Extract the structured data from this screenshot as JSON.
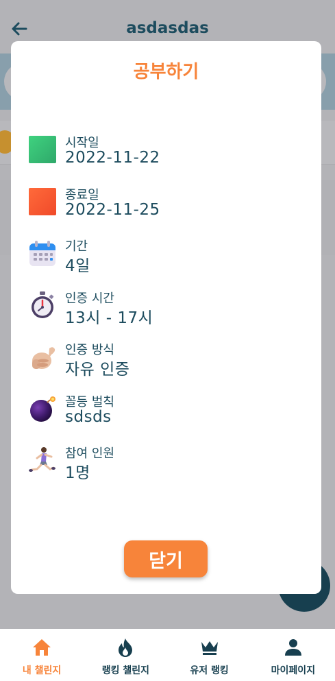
{
  "header": {
    "title": "asdasdas",
    "back_icon": "arrow-left-icon"
  },
  "modal": {
    "title": "공부하기",
    "items": [
      {
        "label": "시작일",
        "value": "2022-11-22",
        "icon": "green-square-icon"
      },
      {
        "label": "종료일",
        "value": "2022-11-25",
        "icon": "orange-square-icon"
      },
      {
        "label": "기간",
        "value": "4일",
        "icon": "calendar-icon"
      },
      {
        "label": "인증 시간",
        "value": "13시 - 17시",
        "icon": "stopwatch-icon"
      },
      {
        "label": "인증 방식",
        "value": "자유 인증",
        "icon": "call-me-hand-icon"
      },
      {
        "label": "꼴등 벌칙",
        "value": "sdsds",
        "icon": "bomb-icon"
      },
      {
        "label": "참여 인원",
        "value": "1명",
        "icon": "running-person-icon"
      }
    ],
    "close_label": "닫기"
  },
  "nav": {
    "items": [
      {
        "label": "내 챌린지",
        "icon": "home-icon",
        "active": true
      },
      {
        "label": "랭킹 챌린지",
        "icon": "fire-icon",
        "active": false
      },
      {
        "label": "유저 랭킹",
        "icon": "crown-icon",
        "active": false
      },
      {
        "label": "마이페이지",
        "icon": "person-icon",
        "active": false
      }
    ]
  },
  "colors": {
    "accent": "#f7843a",
    "primary_text": "#1d4c5e",
    "overlay_bg": "#b3b3b7",
    "fab": "#173f4f"
  }
}
